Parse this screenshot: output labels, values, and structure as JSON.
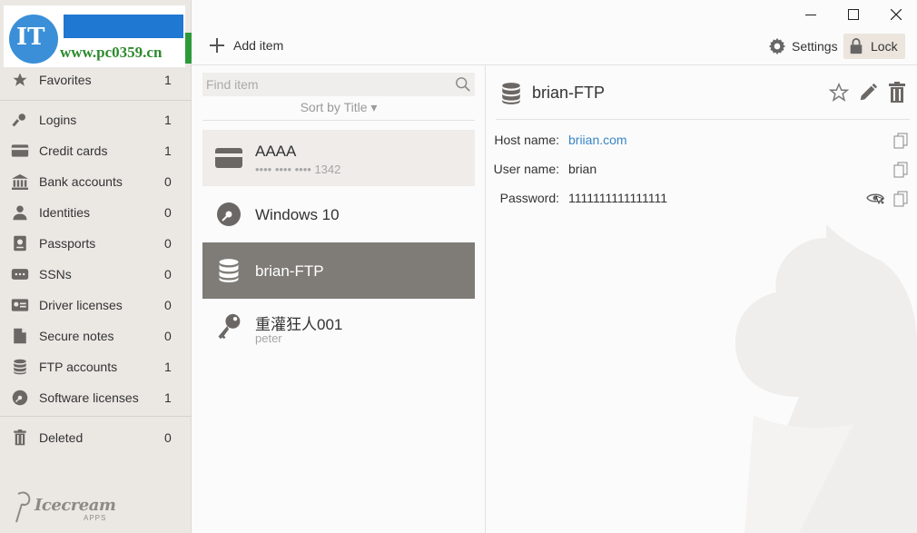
{
  "watermark": {
    "text": "www.pc0359.cn",
    "initials": "IT"
  },
  "sidebar": {
    "items": [
      {
        "label": "Favorites",
        "count": "1",
        "icon": "star-icon"
      },
      {
        "label": "Logins",
        "count": "1",
        "icon": "key-icon"
      },
      {
        "label": "Credit cards",
        "count": "1",
        "icon": "credit-card-icon"
      },
      {
        "label": "Bank accounts",
        "count": "0",
        "icon": "bank-icon"
      },
      {
        "label": "Identities",
        "count": "0",
        "icon": "person-icon"
      },
      {
        "label": "Passports",
        "count": "0",
        "icon": "passport-icon"
      },
      {
        "label": "SSNs",
        "count": "0",
        "icon": "ssn-card-icon"
      },
      {
        "label": "Driver licenses",
        "count": "0",
        "icon": "id-card-icon"
      },
      {
        "label": "Secure notes",
        "count": "0",
        "icon": "note-icon"
      },
      {
        "label": "FTP accounts",
        "count": "1",
        "icon": "database-icon"
      },
      {
        "label": "Software licenses",
        "count": "1",
        "icon": "disc-icon"
      },
      {
        "label": "Deleted",
        "count": "0",
        "icon": "trash-icon"
      }
    ],
    "brand": {
      "name": "Icecream",
      "sub": "APPS"
    }
  },
  "toolbar": {
    "add_label": "Add item",
    "settings_label": "Settings",
    "lock_label": "Lock"
  },
  "list": {
    "search_placeholder": "Find item",
    "sort_label": "Sort by Title ▾",
    "entries": [
      {
        "title": "AAAA",
        "subtitle": "•••• •••• •••• 1342",
        "icon": "credit-card-icon"
      },
      {
        "title": "Windows 10",
        "subtitle": "",
        "icon": "disc-icon"
      },
      {
        "title": "brian-FTP",
        "subtitle": "",
        "icon": "database-icon"
      },
      {
        "title": "重灌狂人001",
        "subtitle": "peter",
        "icon": "key-icon"
      }
    ]
  },
  "detail": {
    "title": "brian-FTP",
    "fields": [
      {
        "key": "Host name:",
        "value": "briian.com"
      },
      {
        "key": "User name:",
        "value": "brian"
      },
      {
        "key": "Password:",
        "value": "1111111111111111"
      }
    ]
  },
  "colors": {
    "sidebar_bg": "#ebe8e4",
    "selected_bg": "#7f7c78",
    "hover_bg": "#efecea",
    "link": "#3a86c8",
    "lock_bg": "#ebe5dd"
  }
}
